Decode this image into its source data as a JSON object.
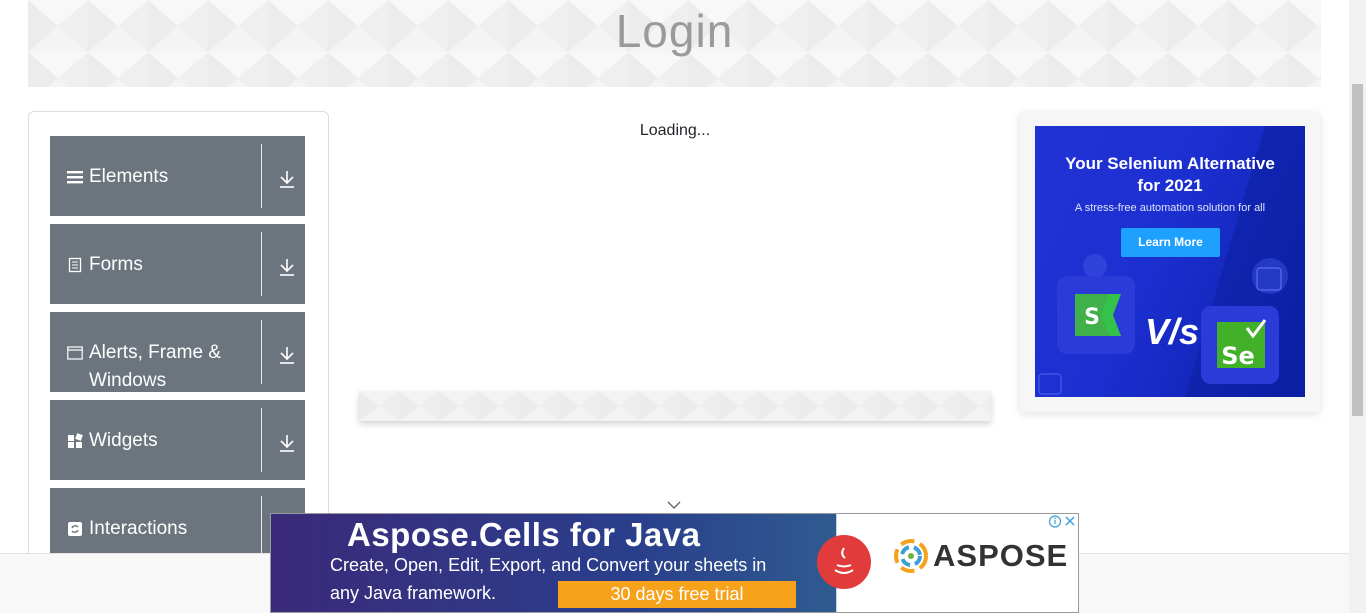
{
  "header": {
    "title": "Login"
  },
  "sidebar": {
    "groups": [
      {
        "label": "Elements",
        "icon": "menu-icon"
      },
      {
        "label": "Forms",
        "icon": "document-icon"
      },
      {
        "label": "Alerts, Frame & Windows",
        "icon": "window-icon"
      },
      {
        "label": "Widgets",
        "icon": "widgets-icon"
      },
      {
        "label": "Interactions",
        "icon": "refresh-icon"
      }
    ]
  },
  "main": {
    "loading_text": "Loading..."
  },
  "right_ad": {
    "title_line1": "Your Selenium Alternative",
    "title_line2": "for 2021",
    "subtitle": "A stress-free automation solution for all",
    "button_label": "Learn More",
    "vs_text": "V/s"
  },
  "bottom_ad": {
    "title": "Aspose.Cells for Java",
    "line1": "Create, Open, Edit, Export, and Convert your sheets in",
    "line2": "any Java framework.",
    "cta": "30 days free trial",
    "brand": "ASPOSE"
  },
  "colors": {
    "group_bg": "#6c757d",
    "ad_blue": "#1c2fd0",
    "trial_orange": "#f6a21b"
  }
}
